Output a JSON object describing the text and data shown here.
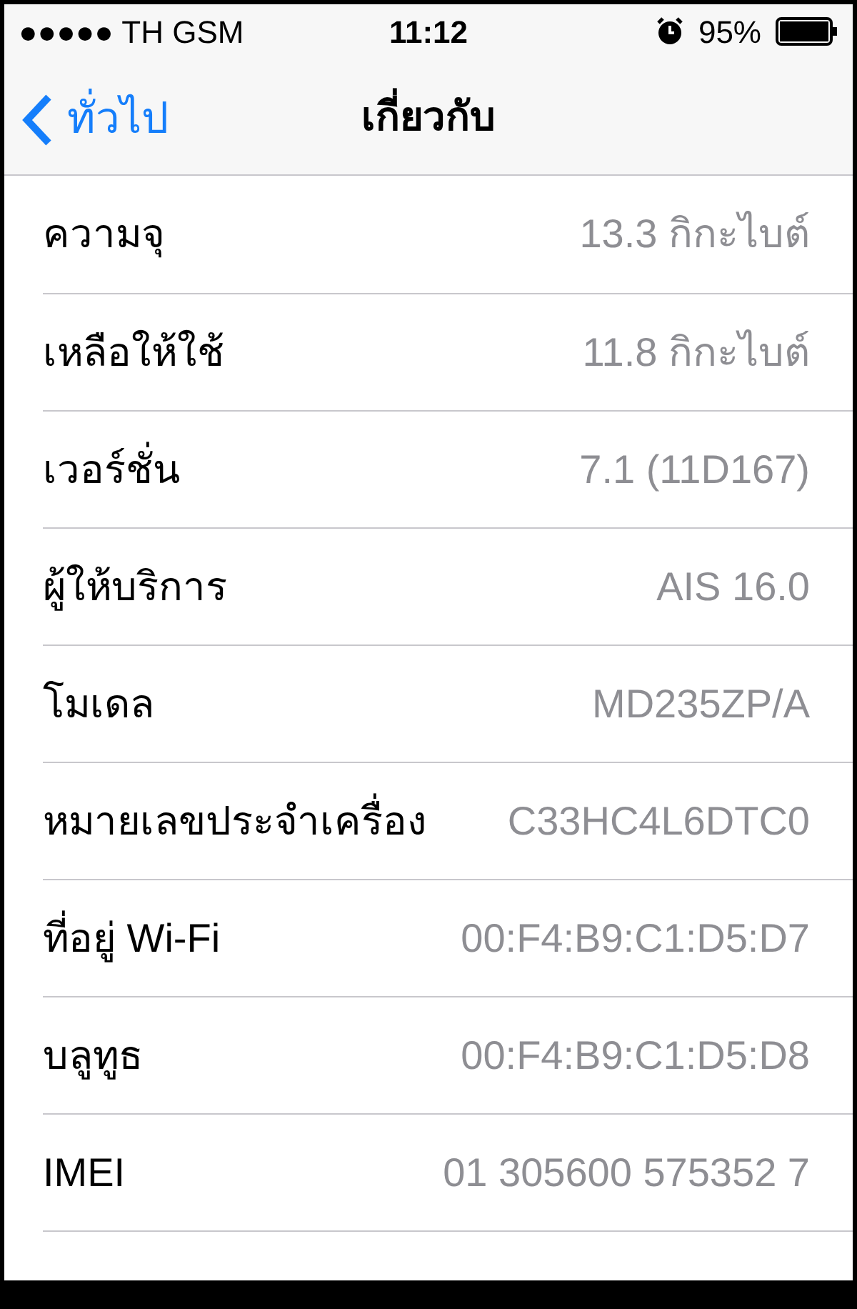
{
  "status_bar": {
    "carrier": "●●●●● TH GSM",
    "time": "11:12",
    "battery": "95%"
  },
  "nav_bar": {
    "back": "ทั่วไป",
    "title": "เกี่ยวกับ"
  },
  "rows": [
    {
      "label": "ความจุ",
      "value": "13.3 กิกะไบต์"
    },
    {
      "label": "เหลือให้ใช้",
      "value": "11.8 กิกะไบต์"
    },
    {
      "label": "เวอร์ชั่น",
      "value": "7.1 (11D167)"
    },
    {
      "label": "ผู้ให้บริการ",
      "value": "AIS 16.0"
    },
    {
      "label": "โมเดล",
      "value": "MD235ZP/A"
    },
    {
      "label": "หมายเลขประจำเครื่อง",
      "value": "C33HC4L6DTC0"
    },
    {
      "label": "ที่อยู่ Wi-Fi",
      "value": "00:F4:B9:C1:D5:D7"
    },
    {
      "label": "บลูทูธ",
      "value": "00:F4:B9:C1:D5:D8"
    },
    {
      "label": "IMEI",
      "value": "01 305600 575352 7"
    }
  ]
}
